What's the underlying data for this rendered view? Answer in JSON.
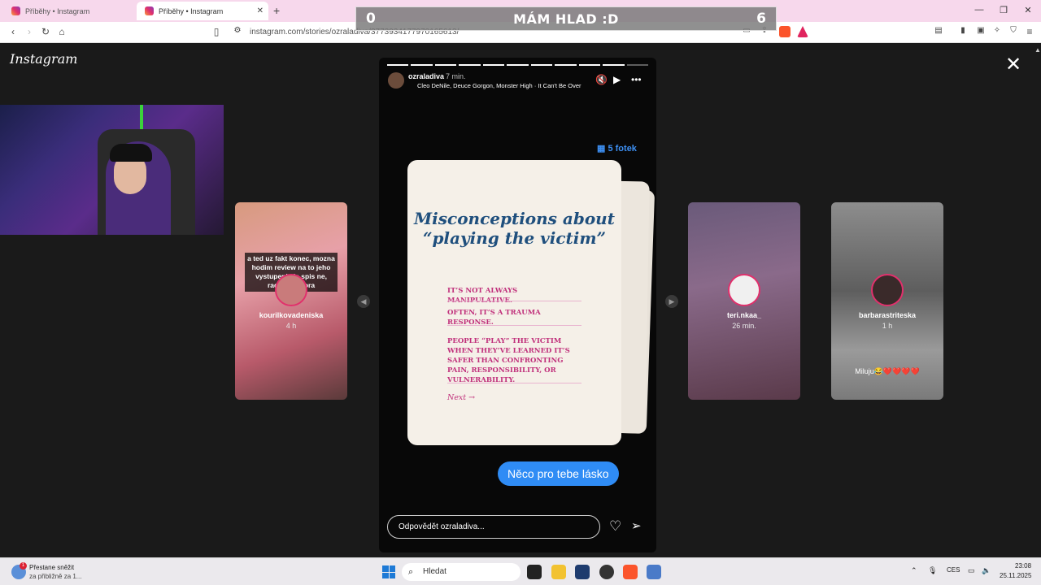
{
  "browser": {
    "tabs": [
      {
        "label": "Příběhy • Instagram",
        "active": false
      },
      {
        "label": "Příběhy • Instagram",
        "active": true
      }
    ],
    "new_tab": "+",
    "url": "instagram.com/stories/ozraladiva/3773934177970165613/"
  },
  "overlay": {
    "score_left": "0",
    "title": "MÁM HLAD :D",
    "score_right": "6"
  },
  "instagram": {
    "logo": "Instagram",
    "close": "✕",
    "left_story": {
      "caption": "a ted uz fakt konec, mozna hodim review na to jeho vystupeni ale spis ne, radsi pokelora",
      "username": "kourilkovadeniska",
      "time": "4 h"
    },
    "story": {
      "username": "ozraladiva",
      "time": "7 min.",
      "music": "Cleo DeNile, Deuce Gorgon, Monster High · It Can't Be Over",
      "photos_badge": "5 fotek",
      "card": {
        "title": "Misconceptions about “playing the victim”",
        "line1": "IT’S NOT ALWAYS MANIPULATIVE.",
        "line2": "OFTEN, IT’S A TRAUMA RESPONSE.",
        "line3": "PEOPLE “PLAY” THE VICTIM WHEN THEY’VE LEARNED IT’S SAFER THAN CONFRONTING PAIN, RESPONSIBILITY, OR VULNERABILITY.",
        "next": "Next →"
      },
      "message_bubble": "Něco pro tebe lásko",
      "reply_placeholder": "Odpovědět ozraladiva...",
      "segments_total": 11,
      "segments_done": 10
    },
    "right_stories": [
      {
        "username": "teri.nkaa_",
        "time": "26 min."
      },
      {
        "username": "barbarastriteska",
        "time": "1 h",
        "caption": "Miluju😂❤️❤️❤️❤️"
      }
    ]
  },
  "taskbar": {
    "weather_line1": "Přestane sněžit",
    "weather_line2": "za přibližně za 1...",
    "weather_badge": "1",
    "search_placeholder": "Hledat",
    "lang": "CES",
    "time": "23:08",
    "date": "25.11.2025"
  },
  "colors": {
    "tab_bar": "#f7d8ec",
    "card_title": "#1f4f7d",
    "card_text": "#c0307b",
    "bubble": "#2f8cf5",
    "photos_badge": "#3d8ff2"
  }
}
